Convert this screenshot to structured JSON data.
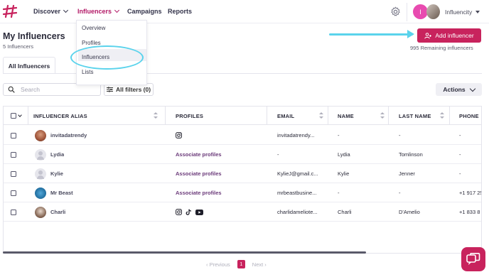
{
  "nav": {
    "items": [
      {
        "label": "Discover"
      },
      {
        "label": "Influencers"
      },
      {
        "label": "Campaigns"
      },
      {
        "label": "Reports"
      }
    ],
    "avatar_initial": "I",
    "account_label": "Influencity",
    "accent_color": "#c8235d"
  },
  "dropdown": {
    "items": [
      {
        "label": "Overview"
      },
      {
        "label": "Profiles"
      },
      {
        "label": "Influencers"
      },
      {
        "label": "Lists"
      }
    ]
  },
  "page": {
    "title": "My Influencers",
    "subtitle": "5 Influencers",
    "add_button": "Add influencer",
    "remaining": "995 Remaining influencers"
  },
  "tabs": [
    {
      "label": "All Influencers"
    }
  ],
  "search": {
    "placeholder": "Search"
  },
  "filters": {
    "label": "All filters (0)"
  },
  "actions": {
    "label": "Actions"
  },
  "table": {
    "columns": [
      "INFLUENCER ALIAS",
      "PROFILES",
      "EMAIL",
      "NAME",
      "LAST NAME",
      "PHONE"
    ],
    "rows": [
      {
        "alias": "invitadatrendy",
        "profiles": "",
        "email": "invitadatrendy...",
        "name": "-",
        "last_name": "-",
        "phone": "-"
      },
      {
        "alias": "Lydia",
        "profiles": "Associate profiles",
        "email": "-",
        "name": "Lydia",
        "last_name": "Tomlinson",
        "phone": "-"
      },
      {
        "alias": "Kylie",
        "profiles": "Associate profiles",
        "email": "KylieJ@gmail.c...",
        "name": "Kylie",
        "last_name": "Jenner",
        "phone": "-"
      },
      {
        "alias": "Mr Beast",
        "profiles": "Associate profiles",
        "email": "mrbeastbusine...",
        "name": "-",
        "last_name": "-",
        "phone": "+1 917 25"
      },
      {
        "alias": "Charli",
        "profiles": "",
        "email": "charlidameliote...",
        "name": "Charli",
        "last_name": "D'Amelio",
        "phone": "+1 833 8"
      }
    ]
  },
  "pagination": {
    "previous": "Previous",
    "current": "1",
    "next": "Next"
  }
}
